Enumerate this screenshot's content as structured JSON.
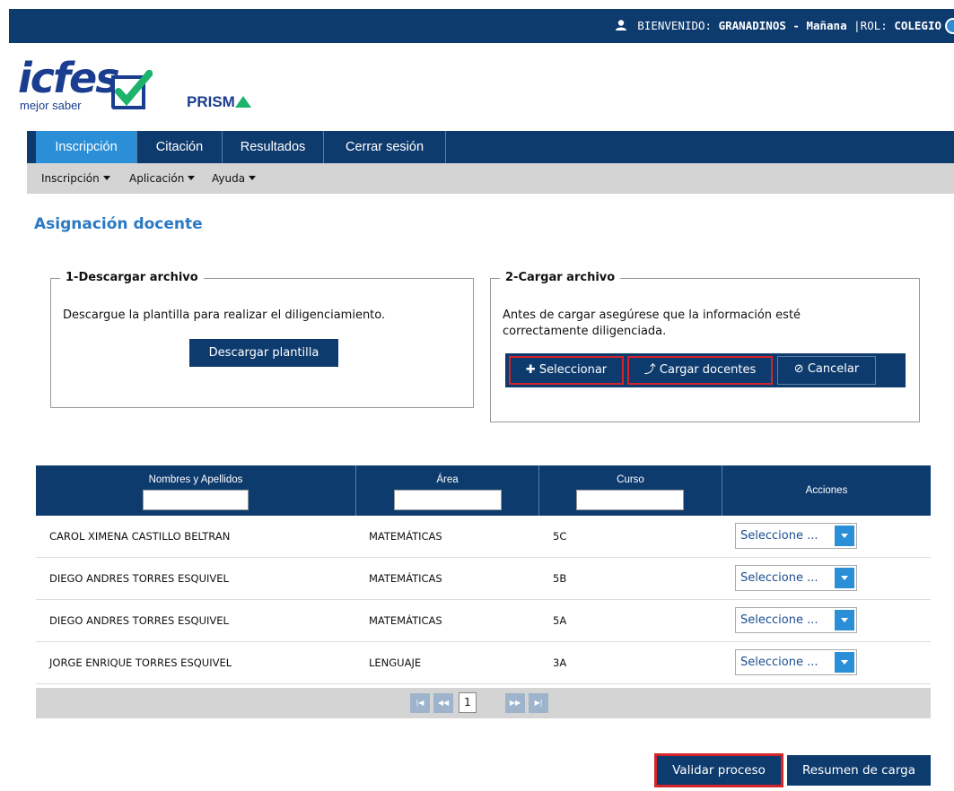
{
  "header": {
    "welcome_label": "BIENVENIDO:",
    "user_name": "GRANADINOS - Mañana",
    "role_label": "|ROL:",
    "role_value": "COLEGIO"
  },
  "brand": {
    "logo_text": "icfes",
    "logo_sub": "mejor saber",
    "product_prefix": "PRISM",
    "accent_color": "#1db36b",
    "primary_color": "#0e3b6e",
    "highlight_color": "#d4232a"
  },
  "nav": {
    "tabs": [
      "Inscripción",
      "Citación",
      "Resultados",
      "Cerrar sesión"
    ],
    "active": "Inscripción"
  },
  "subnav": {
    "items": [
      "Inscripción",
      "Aplicación",
      "Ayuda"
    ]
  },
  "page": {
    "title": "Asignación docente"
  },
  "download": {
    "legend": "1-Descargar archivo",
    "text": "Descargue la plantilla para realizar el diligenciamiento.",
    "button": "Descargar plantilla"
  },
  "upload": {
    "legend": "2-Cargar archivo",
    "text": "Antes de cargar asegúrese que la información esté correctamente diligenciada.",
    "select_button": "Seleccionar",
    "upload_button": "Cargar docentes",
    "cancel_button": "Cancelar"
  },
  "table": {
    "columns": [
      "Nombres y Apellidos",
      "Área",
      "Curso",
      "Acciones"
    ],
    "rows": [
      {
        "name": "CAROL XIMENA CASTILLO BELTRAN",
        "area": "MATEMÁTICAS",
        "curso": "5C",
        "action": "Seleccione ..."
      },
      {
        "name": "DIEGO ANDRES TORRES ESQUIVEL",
        "area": "MATEMÁTICAS",
        "curso": "5B",
        "action": "Seleccione ..."
      },
      {
        "name": "DIEGO ANDRES TORRES ESQUIVEL",
        "area": "MATEMÁTICAS",
        "curso": "5A",
        "action": "Seleccione ..."
      },
      {
        "name": "JORGE ENRIQUE TORRES ESQUIVEL",
        "area": "LENGUAJE",
        "curso": "3A",
        "action": "Seleccione ..."
      }
    ]
  },
  "pager": {
    "current_page": "1"
  },
  "footer": {
    "validate_button": "Validar proceso",
    "summary_button": "Resumen de carga"
  }
}
